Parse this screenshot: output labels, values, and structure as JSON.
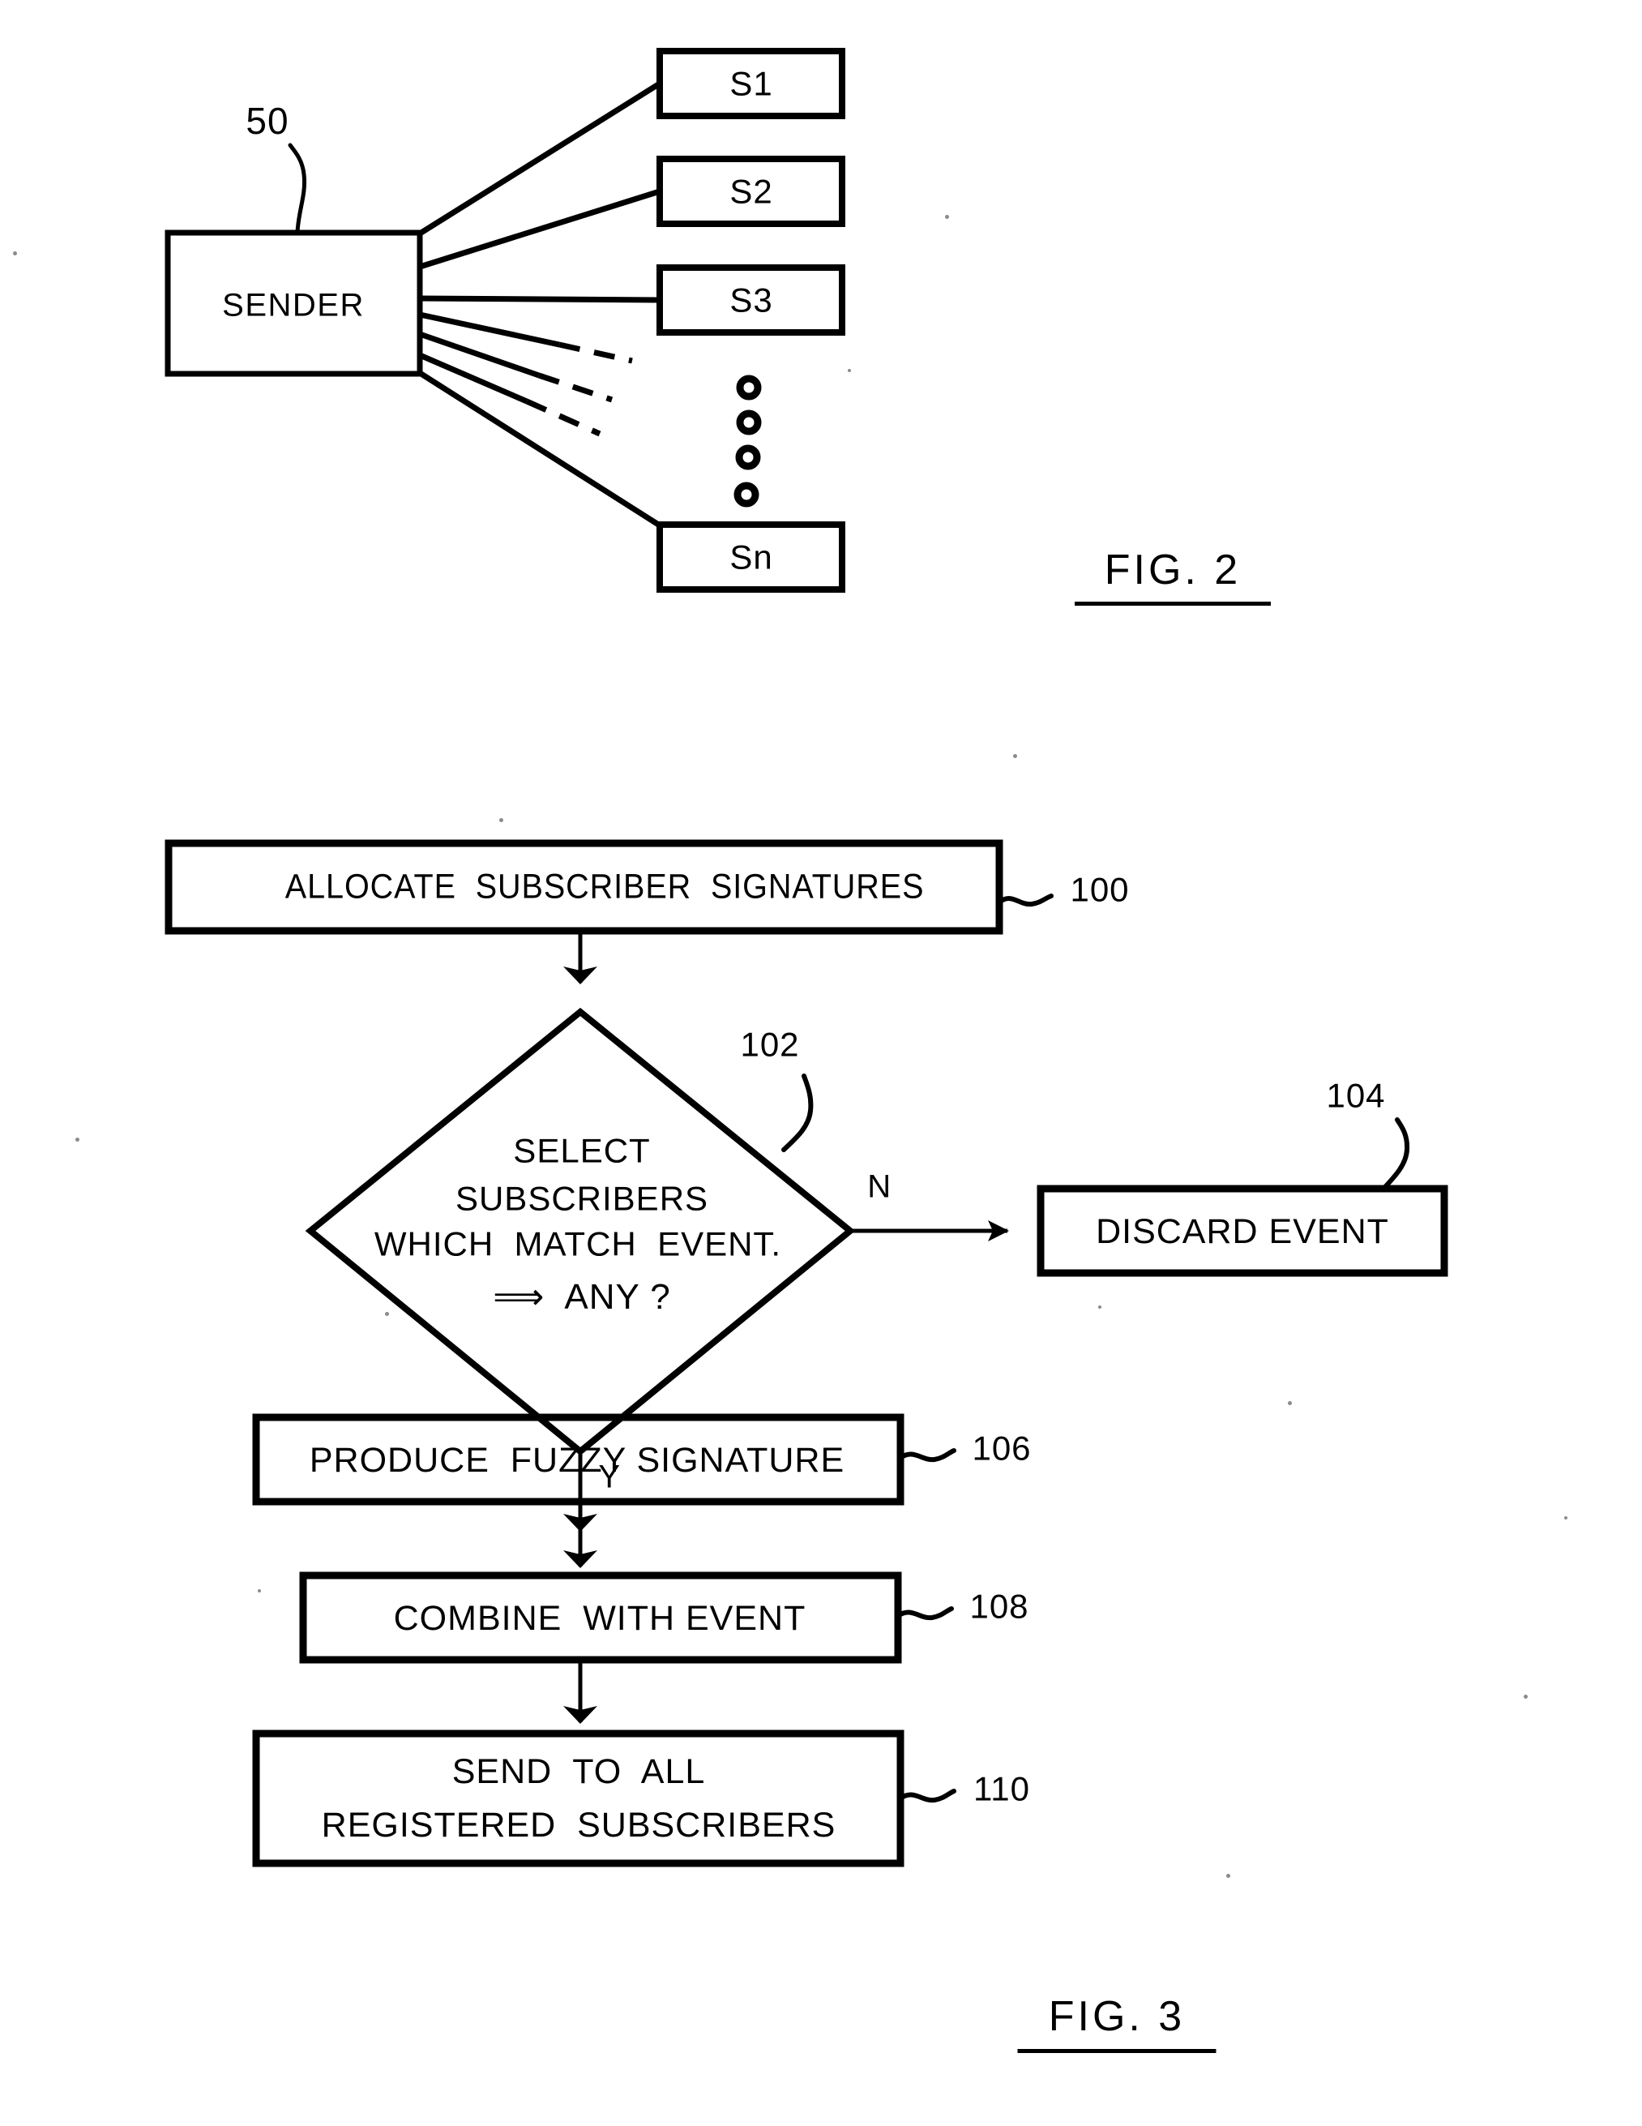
{
  "document": {
    "type": "patent-drawing-sheet",
    "figures": [
      "FIG. 2",
      "FIG. 3"
    ]
  },
  "figure2": {
    "title": "FIG. 2",
    "sender": {
      "label": "SENDER",
      "callout": "50"
    },
    "subscribers": [
      {
        "label": "S1"
      },
      {
        "label": "S2"
      },
      {
        "label": "S3"
      },
      {
        "label": "Sn"
      }
    ],
    "ellipsis_marker": "vertical-circles",
    "ellipsis_count": 4
  },
  "figure3": {
    "title": "FIG. 3",
    "steps": [
      {
        "id": "100",
        "shape": "process",
        "label": "ALLOCATE  SUBSCRIBER  SIGNATURES",
        "callout": "100"
      },
      {
        "id": "102",
        "shape": "decision",
        "callout": "102",
        "lines": [
          "SELECT",
          "SUBSCRIBERS",
          "WHICH  MATCH  EVENT.",
          "⟹  ANY ?"
        ],
        "branches": [
          {
            "letter": "N",
            "target": "104"
          },
          {
            "letter": "Y",
            "target": "106"
          }
        ]
      },
      {
        "id": "104",
        "shape": "process",
        "label": "DISCARD EVENT",
        "callout": "104"
      },
      {
        "id": "106",
        "shape": "process",
        "label": "PRODUCE  FUZZY SIGNATURE",
        "callout": "106"
      },
      {
        "id": "108",
        "shape": "process",
        "label": "COMBINE  WITH EVENT",
        "callout": "108"
      },
      {
        "id": "110",
        "shape": "process",
        "lines": [
          "SEND  TO  ALL",
          "REGISTERED  SUBSCRIBERS"
        ],
        "callout": "110"
      }
    ]
  },
  "style": {
    "ink": "#000000",
    "paper": "#ffffff"
  }
}
